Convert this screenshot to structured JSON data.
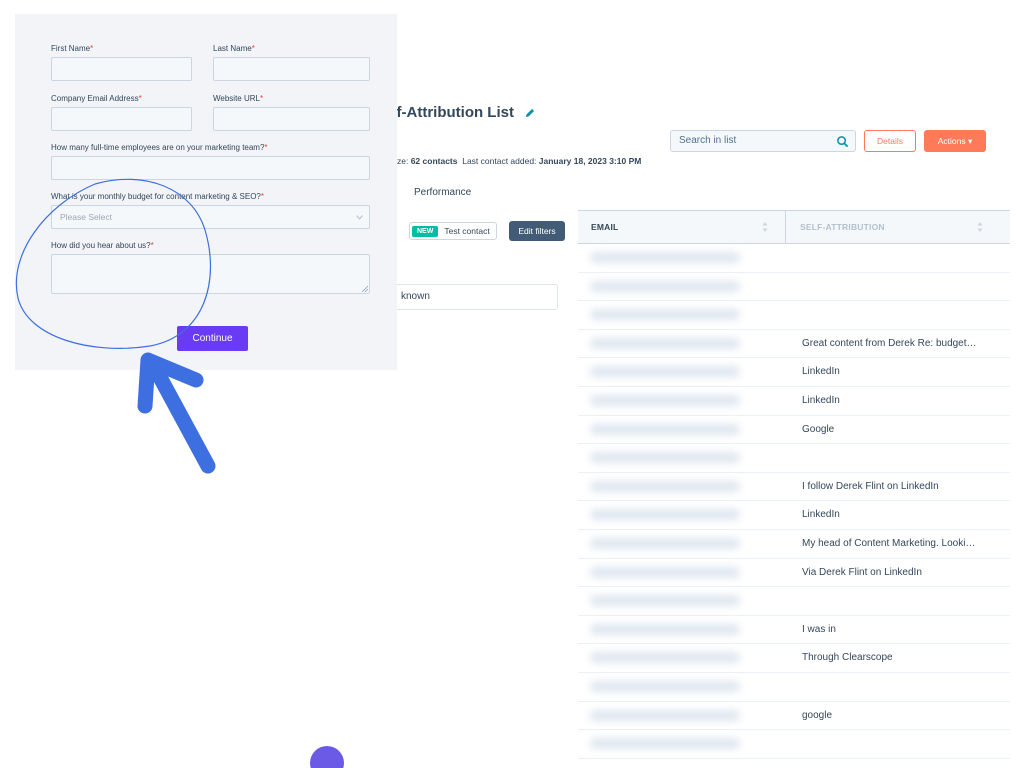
{
  "list": {
    "title": "elf-Attribution List",
    "size_prefix": "ze: ",
    "size_value": "62 contacts",
    "last_added_label": "Last contact added: ",
    "last_added_value": "January 18, 2023 3:10 PM",
    "search_placeholder": "Search in list",
    "details_label": "Details",
    "actions_label": "Actions ▾",
    "tab_performance": "Performance",
    "new_badge": "NEW",
    "test_contact_label": "Test contact",
    "edit_filters_label": "Edit filters",
    "filter_value": "known",
    "columns": [
      "EMAIL",
      "SELF-ATTRIBUTION"
    ],
    "rows": [
      {
        "attribution": "",
        "blurred": true
      },
      {
        "attribution": "",
        "blurred": true
      },
      {
        "attribution": "",
        "blurred": true
      },
      {
        "attribution": "Great content from Derek Re: budget…",
        "blurred": false
      },
      {
        "attribution": "LinkedIn",
        "blurred": false
      },
      {
        "attribution": "LinkedIn",
        "blurred": false
      },
      {
        "attribution": "Google",
        "blurred": false
      },
      {
        "attribution": "",
        "blurred": true
      },
      {
        "attribution": "I follow Derek Flint on LinkedIn",
        "blurred": false
      },
      {
        "attribution": "LinkedIn",
        "blurred": false
      },
      {
        "attribution": "My head of Content Marketing. Looki…",
        "blurred": false
      },
      {
        "attribution": "Via Derek Flint on LinkedIn",
        "blurred": false
      },
      {
        "attribution": "",
        "blurred": true
      },
      {
        "attribution": "I was in",
        "blurred": false
      },
      {
        "attribution": "Through Clearscope",
        "blurred": false
      },
      {
        "attribution": "",
        "blurred": true
      },
      {
        "attribution": "google",
        "blurred": false
      },
      {
        "attribution": "",
        "blurred": true
      }
    ]
  },
  "form": {
    "first_name_label": "First Name",
    "last_name_label": "Last Name",
    "company_email_label": "Company Email Address",
    "website_label": "Website URL",
    "employees_label": "How many full-time employees are on your marketing team?",
    "budget_label": "What is your monthly budget for content marketing & SEO?",
    "budget_placeholder": "Please Select",
    "heard_label": "How did you hear about us?",
    "required_marker": "*",
    "continue_label": "Continue"
  },
  "colors": {
    "accent_orange": "#ff7a59",
    "continue_purple": "#6a3bf5",
    "annotation_blue": "#3d6fe0",
    "new_badge_teal": "#00bda5"
  },
  "icons": [
    "pencil-icon",
    "search-icon",
    "sort-icon",
    "chevron-down-icon",
    "arrow-annotation",
    "circle-annotation"
  ]
}
